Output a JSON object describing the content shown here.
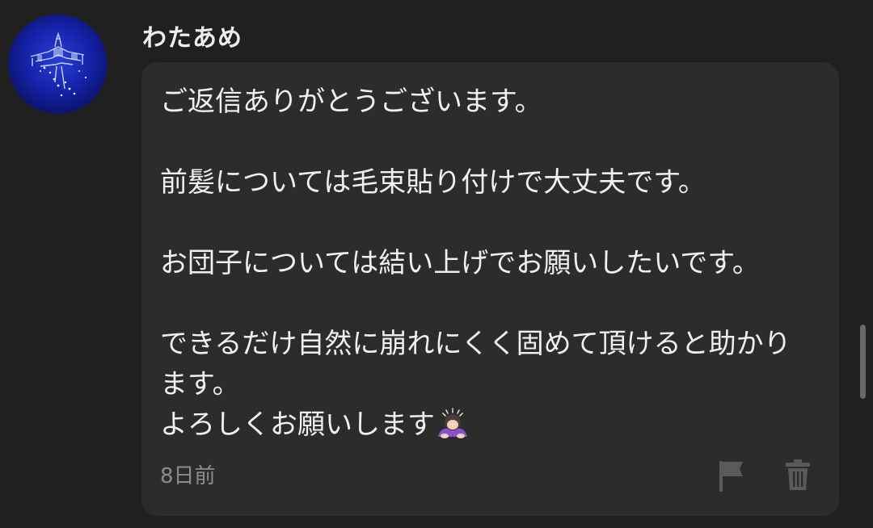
{
  "comment": {
    "username": "わたあめ",
    "message_lines": [
      "ご返信ありがとうございます。",
      "",
      "前髪については毛束貼り付けで大丈夫です。",
      "",
      "お団子については結い上げでお願いしたいです。",
      "",
      "できるだけ自然に崩れにくく固めて頂けると助かります。",
      "よろしくお願いします"
    ],
    "emoji": "person-bowing-emoji",
    "timestamp": "8日前",
    "avatar_icon": "castle-night-avatar",
    "actions": {
      "report_icon": "flag-icon",
      "delete_icon": "trash-icon"
    }
  }
}
